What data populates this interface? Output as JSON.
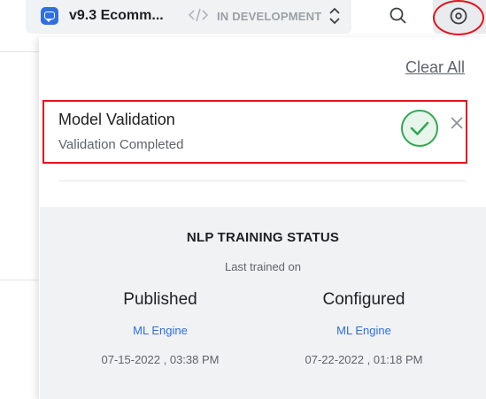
{
  "header": {
    "app_name": "v9.3 Ecomm...",
    "environment": "IN DEVELOPMENT",
    "icons": [
      "bot-icon",
      "code-icon",
      "chevron-updown-icon",
      "search-icon",
      "notification-disc-icon"
    ]
  },
  "panel": {
    "clear_all": "Clear All",
    "notification": {
      "title": "Model Validation",
      "subtitle": "Validation Completed",
      "status_color": "#34a853"
    },
    "training": {
      "title": "NLP TRAINING STATUS",
      "last_trained_label": "Last trained on",
      "columns": [
        {
          "heading": "Published",
          "engine": "ML Engine",
          "date": "07-15-2022 , 03:38 PM"
        },
        {
          "heading": "Configured",
          "engine": "ML Engine",
          "date": "07-22-2022 , 01:18 PM"
        }
      ]
    }
  },
  "colors": {
    "accent": "#2f6fe0",
    "highlight": "#e3121b",
    "success": "#34a853"
  }
}
